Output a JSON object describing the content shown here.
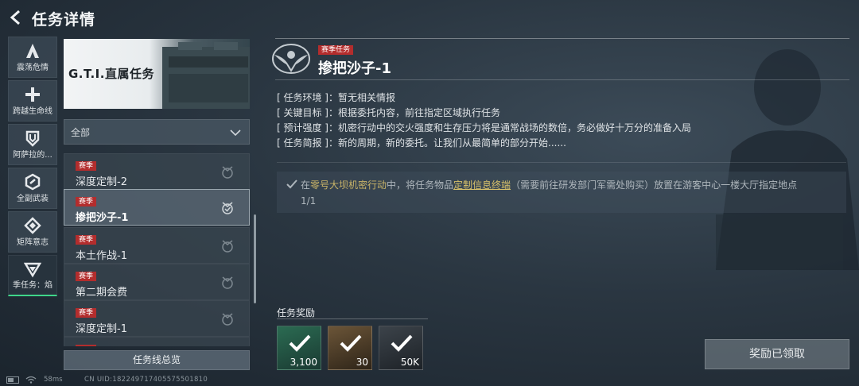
{
  "header": {
    "title": "任务详情"
  },
  "rail": {
    "items": [
      {
        "label": "震荡危情",
        "icon": "a-shape-icon"
      },
      {
        "label": "跨越生命线",
        "icon": "plus-icon"
      },
      {
        "label": "阿萨拉的...",
        "icon": "shield-icon"
      },
      {
        "label": "全副武装",
        "icon": "hex-icon"
      },
      {
        "label": "矩阵意志",
        "icon": "diamond-icon"
      },
      {
        "label": "季任务：焰",
        "icon": "triangle-v-icon",
        "active": true
      }
    ]
  },
  "banner": {
    "title": "G.T.I.直属任务"
  },
  "filter": {
    "value": "全部"
  },
  "tasks": [
    {
      "tag": "赛季",
      "name": "深度定制-2"
    },
    {
      "tag": "赛季",
      "name": "掺把沙子-1",
      "active": true
    },
    {
      "tag": "赛季",
      "name": "本土作战-1"
    },
    {
      "tag": "赛季",
      "name": "第二期会费"
    },
    {
      "tag": "赛季",
      "name": "深度定制-1"
    }
  ],
  "overview_button": "任务线总览",
  "status": {
    "ping": "58ms",
    "uid": "CN UID:182249717405575501810"
  },
  "detail": {
    "tag": "赛季任务",
    "title": "掺把沙子-1",
    "rows": [
      {
        "key": "[ 任务环境 ]",
        "value": "：暂无相关情报"
      },
      {
        "key": "[ 关键目标 ]",
        "value": "：根据委托内容，前往指定区域执行任务"
      },
      {
        "key": "[ 预计强度 ]",
        "value": "：机密行动中的交火强度和生存压力将是通常战场的数倍，务必做好十万分的准备入局"
      },
      {
        "key": "[ 任务简报 ]",
        "value": "：新的周期，新的委托。让我们从最简单的部分开始......"
      }
    ],
    "objective": {
      "pre": "在",
      "map": "零号大坝机密行动",
      "mid": "中，将任务物品",
      "item": "定制信息终端",
      "post": "（需要前往研发部门军需处购买）放置在游客中心一楼大厅指定地点",
      "progress": "1/1"
    }
  },
  "rewards": {
    "label": "任务奖励",
    "items": [
      {
        "qty": "3,100"
      },
      {
        "qty": "30"
      },
      {
        "qty": "50K"
      }
    ]
  },
  "claim_button": "奖励已领取",
  "colors": {
    "accent_green": "#3fd68a",
    "tag_red": "#b32d2d",
    "highlight_gold": "#d6c06a"
  }
}
